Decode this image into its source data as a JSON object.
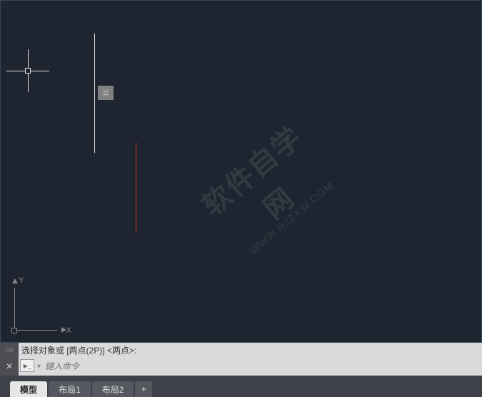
{
  "canvas": {
    "badge_text": "31",
    "ucs": {
      "x_label": "X",
      "y_label": "Y"
    }
  },
  "command": {
    "history_line": "选择对象或 [两点(2P)] <两点>:",
    "prompt_icon": "▶_",
    "input_placeholder": "键入命令"
  },
  "tabs": {
    "items": [
      {
        "label": "模型",
        "active": true
      },
      {
        "label": "布局1",
        "active": false
      },
      {
        "label": "布局2",
        "active": false
      }
    ],
    "add_label": "+"
  },
  "watermark": {
    "large": "软件自学网",
    "small": "WWW.RJZXW.COM"
  }
}
